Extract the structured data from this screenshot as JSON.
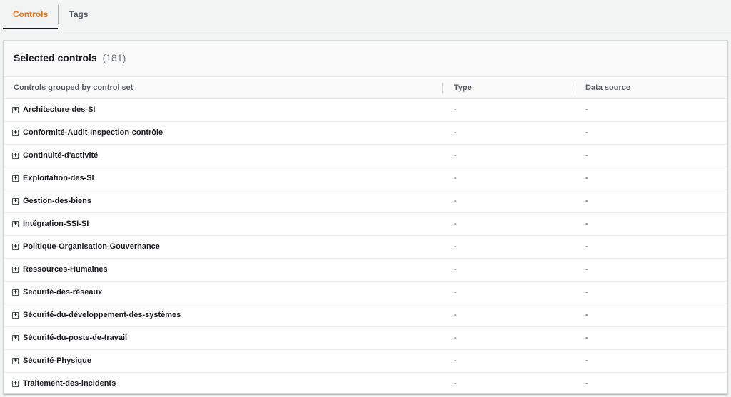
{
  "tabs": [
    {
      "label": "Controls",
      "active": true
    },
    {
      "label": "Tags",
      "active": false
    }
  ],
  "panel": {
    "title": "Selected controls",
    "count": "(181)"
  },
  "table": {
    "columns": [
      "Controls grouped by control set",
      "Type",
      "Data source"
    ],
    "rows": [
      {
        "name": "Architecture-des-SI",
        "type": "-",
        "source": "-"
      },
      {
        "name": "Conformité-Audit-Inspection-contrôle",
        "type": "-",
        "source": "-"
      },
      {
        "name": "Continuité-d'activité",
        "type": "-",
        "source": "-"
      },
      {
        "name": "Exploitation-des-SI",
        "type": "-",
        "source": "-"
      },
      {
        "name": "Gestion-des-biens",
        "type": "-",
        "source": "-"
      },
      {
        "name": "Intégration-SSI-SI",
        "type": "-",
        "source": "-"
      },
      {
        "name": "Politique-Organisation-Gouvernance",
        "type": "-",
        "source": "-"
      },
      {
        "name": "Ressources-Humaines",
        "type": "-",
        "source": "-"
      },
      {
        "name": "Securité-des-réseaux",
        "type": "-",
        "source": "-"
      },
      {
        "name": "Sécurité-du-développement-des-systèmes",
        "type": "-",
        "source": "-"
      },
      {
        "name": "Sécurité-du-poste-de-travail",
        "type": "-",
        "source": "-"
      },
      {
        "name": "Sécurité-Physique",
        "type": "-",
        "source": "-"
      },
      {
        "name": "Traitement-des-incidents",
        "type": "-",
        "source": "-"
      }
    ],
    "expander_icon": "plus-box-icon"
  },
  "colors": {
    "accent": "#ec7211",
    "text": "#16191f",
    "muted": "#545b64"
  }
}
